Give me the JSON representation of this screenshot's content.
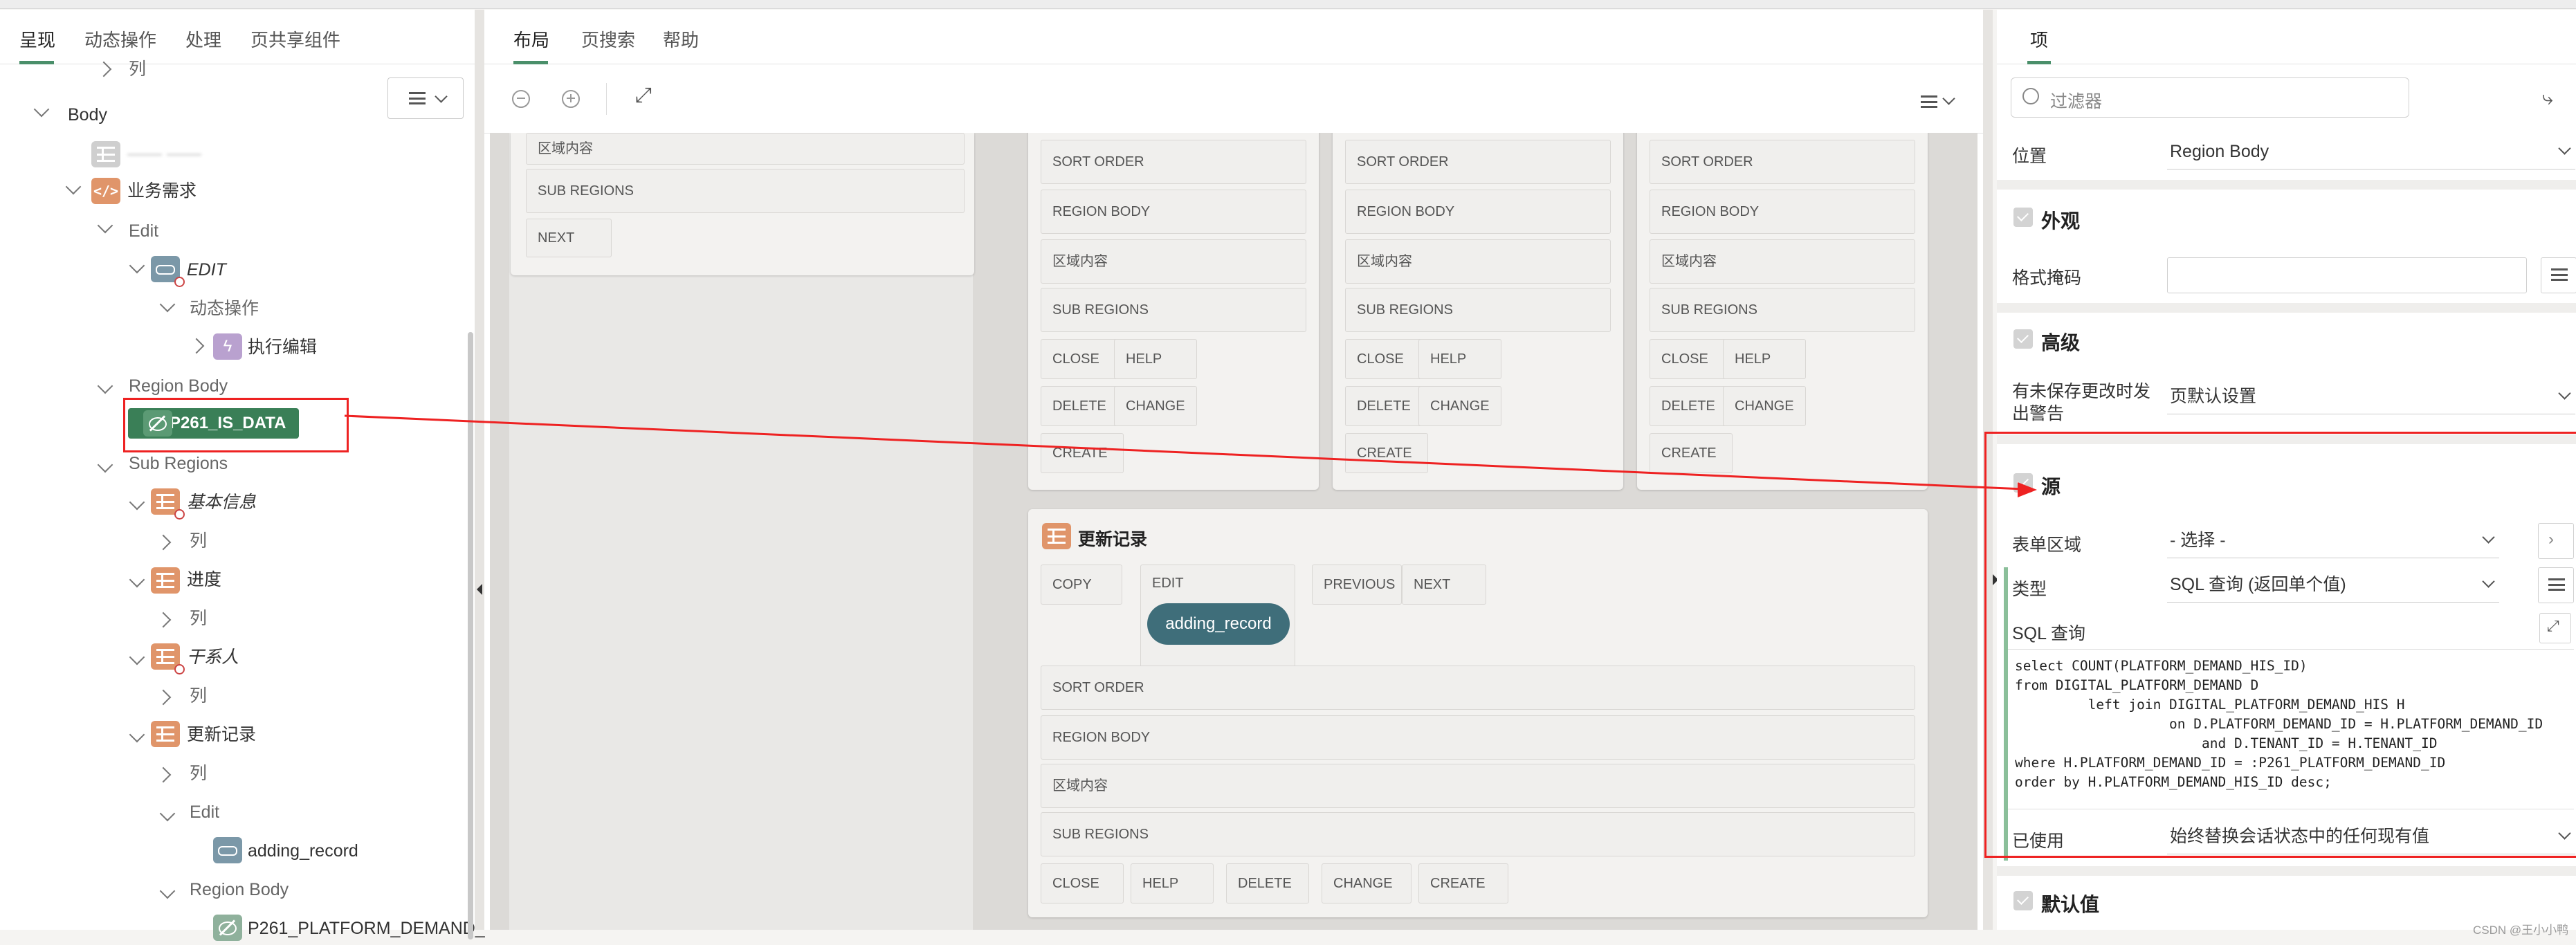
{
  "left": {
    "tabs": [
      "呈现",
      "动态操作",
      "处理",
      "页共享组件"
    ],
    "tree": {
      "col_top": "列",
      "body": "Body",
      "blurred_item": "—— ——",
      "business": "业务需求",
      "edit": "Edit",
      "edit_button": "EDIT",
      "dynamic_actions": "动态操作",
      "exec_edit": "执行编辑",
      "region_body": "Region Body",
      "selected_item": "P261_IS_DATA",
      "sub_regions": "Sub Regions",
      "basic_info": "基本信息",
      "col1": "列",
      "progress": "进度",
      "col2": "列",
      "stakeholder": "干系人",
      "col3": "列",
      "update_record": "更新记录",
      "col4": "列",
      "edit2": "Edit",
      "adding_record": "adding_record",
      "region_body2": "Region Body",
      "platform_item": "P261_PLATFORM_DEMAND_"
    }
  },
  "middle": {
    "tabs": [
      "布局",
      "页搜索",
      "帮助"
    ],
    "top_left_box": [
      "区域内容",
      "SUB REGIONS",
      "NEXT"
    ],
    "col_boxes": [
      {
        "slots": [
          "SORT ORDER",
          "REGION BODY",
          "区域内容",
          "SUB REGIONS"
        ],
        "buttons": [
          "CLOSE",
          "HELP",
          "DELETE",
          "CHANGE",
          "CREATE"
        ]
      },
      {
        "slots": [
          "SORT ORDER",
          "REGION BODY",
          "区域内容",
          "SUB REGIONS"
        ],
        "buttons": [
          "CLOSE",
          "HELP",
          "DELETE",
          "CHANGE",
          "CREATE"
        ]
      },
      {
        "slots": [
          "SORT ORDER",
          "REGION BODY",
          "区域内容",
          "SUB REGIONS"
        ],
        "buttons": [
          "CLOSE",
          "HELP",
          "DELETE",
          "CHANGE",
          "CREATE"
        ]
      }
    ],
    "update_panel": {
      "title": "更新记录",
      "top_buttons": [
        "COPY",
        "EDIT",
        "PREVIOUS",
        "NEXT"
      ],
      "pill": "adding_record",
      "slots": [
        "SORT ORDER",
        "REGION BODY",
        "区域内容",
        "SUB REGIONS"
      ],
      "bottom_buttons": [
        "CLOSE",
        "HELP",
        "DELETE",
        "CHANGE",
        "CREATE"
      ]
    }
  },
  "right": {
    "tab": "项",
    "filter_placeholder": "过滤器",
    "position_label": "位置",
    "position_value": "Region Body",
    "appearance": "外观",
    "format_mask": "格式掩码",
    "advanced": "高级",
    "warn_label_1": "有未保存更改时发",
    "warn_label_2": "出警告",
    "warn_value": "页默认设置",
    "source": "源",
    "form_region": "表单区域",
    "form_region_value": "- 选择 -",
    "type_label": "类型",
    "type_value": "SQL 查询 (返回单个值)",
    "sql_label": "SQL 查询",
    "sql_lines": [
      "select COUNT(PLATFORM_DEMAND_HIS_ID)",
      "from DIGITAL_PLATFORM_DEMAND D",
      "         left join DIGITAL_PLATFORM_DEMAND_HIS H",
      "                   on D.PLATFORM_DEMAND_ID = H.PLATFORM_DEMAND_ID",
      "                       and D.TENANT_ID = H.TENANT_ID",
      "where H.PLATFORM_DEMAND_ID = :P261_PLATFORM_DEMAND_ID",
      "order by H.PLATFORM_DEMAND_HIS_ID desc;"
    ],
    "used_label": "已使用",
    "used_value": "始终替换会话状态中的任何现有值",
    "default_value": "默认值",
    "watermark": "CSDN @王小小鸭"
  },
  "colors": {
    "accent": "#4a8f6a",
    "annotation": "#e22222",
    "pill": "#3f6e7a"
  }
}
